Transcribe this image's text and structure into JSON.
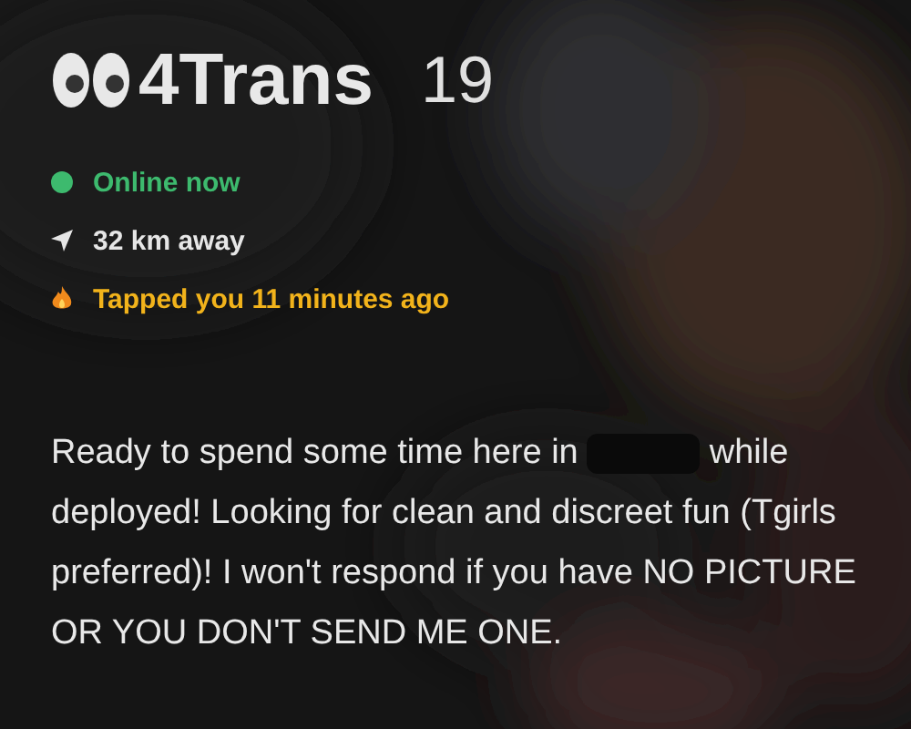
{
  "profile": {
    "name": "4Trans",
    "age": "19"
  },
  "status": [
    {
      "kind": "online",
      "text": "Online now",
      "color": "#3dba6e"
    },
    {
      "kind": "distance",
      "text": "32 km away",
      "color": "#e6e6e6"
    },
    {
      "kind": "tap",
      "text": "Tapped you 11 minutes ago",
      "color": "#f2b31b"
    }
  ],
  "bio": [
    {
      "kind": "text",
      "text": "Ready to spend some time here in"
    },
    {
      "kind": "redacted"
    },
    {
      "kind": "text",
      "text": "while"
    },
    {
      "kind": "paragraph",
      "text": "deployed! Looking for clean and discreet fun (Tgirls preferred)! I won't respond if you have NO PICTURE OR YOU DON'T SEND ME ONE."
    }
  ]
}
